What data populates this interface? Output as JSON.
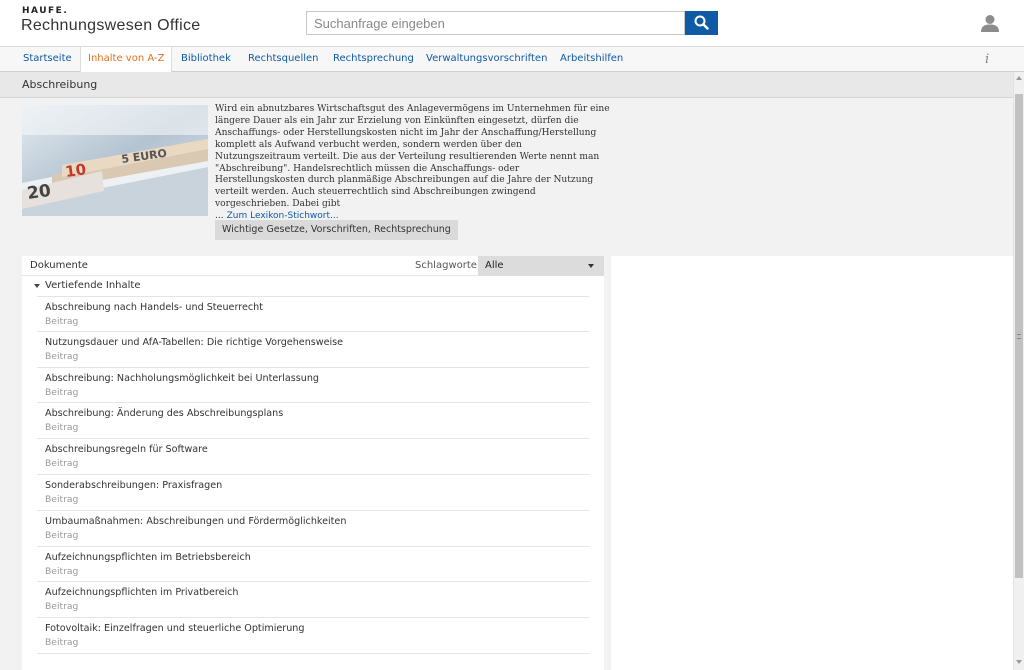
{
  "header": {
    "brand_small": "HAUFE.",
    "brand_title": "Rechnungswesen Office",
    "search_placeholder": "Suchanfrage eingeben",
    "icons": {
      "search": "search-icon",
      "user": "user-icon"
    }
  },
  "nav": {
    "items": [
      {
        "label": "Startseite"
      },
      {
        "label": "Inhalte von A-Z",
        "active": true
      },
      {
        "label": "Bibliothek"
      },
      {
        "label": "Rechtsquellen"
      },
      {
        "label": "Rechtsprechung"
      },
      {
        "label": "Verwaltungsvorschriften"
      },
      {
        "label": "Arbeitshilfen"
      }
    ],
    "info_label": "i"
  },
  "page": {
    "title": "Abschreibung"
  },
  "lexikon": {
    "text": "Wird ein abnutzbares Wirtschaftsgut des Anlagevermögens im Unternehmen für eine längere Dauer als ein Jahr zur Erzielung von Einkünften eingesetzt, dürfen die Anschaffungs- oder Herstellungskosten nicht im Jahr der Anschaffung/Herstellung komplett als Aufwand verbucht werden, sondern werden über den Nutzungszeitraum verteilt. Die aus der Verteilung resultierenden Werte nennt man \"Abschreibung\". Handelsrechtlich müssen die Anschaffungs- oder Herstellungskosten durch planmäßige Abschreibungen auf die Jahre der Nutzung verteilt werden. Auch steuerrechtlich sind Abschreibungen zwingend vorgeschrieben. Dabei gibt",
    "ellipsis": "...",
    "link_label": "Zum Lexikon-Stichwort...",
    "button_label": "Wichtige Gesetze, Vorschriften, Rechtsprechung",
    "image_text": "10  5 EURO  20"
  },
  "documents": {
    "title": "Dokumente",
    "filter_label": "Schlagworte:",
    "filter_value": "Alle",
    "group_label": "Vertiefende Inhalte",
    "items": [
      {
        "title": "Abschreibung nach Handels- und Steuerrecht",
        "type": "Beitrag"
      },
      {
        "title": "Nutzungsdauer und AfA-Tabellen: Die richtige Vorgehensweise",
        "type": "Beitrag"
      },
      {
        "title": "Abschreibung: Nachholungsmöglichkeit bei Unterlassung",
        "type": "Beitrag"
      },
      {
        "title": "Abschreibung: Änderung des Abschreibungsplans",
        "type": "Beitrag"
      },
      {
        "title": "Abschreibungsregeln für Software",
        "type": "Beitrag"
      },
      {
        "title": "Sonderabschreibungen: Praxisfragen",
        "type": "Beitrag"
      },
      {
        "title": "Umbaumaßnahmen: Abschreibungen und Fördermöglichkeiten",
        "type": "Beitrag"
      },
      {
        "title": "Aufzeichnungspflichten im Betriebsbereich",
        "type": "Beitrag"
      },
      {
        "title": "Aufzeichnungspflichten im Privatbereich",
        "type": "Beitrag"
      },
      {
        "title": "Fotovoltaik: Einzelfragen und steuerliche Optimierung",
        "type": "Beitrag"
      }
    ]
  },
  "colors": {
    "accent_blue": "#0f5aa6",
    "active_orange": "#e07020"
  }
}
